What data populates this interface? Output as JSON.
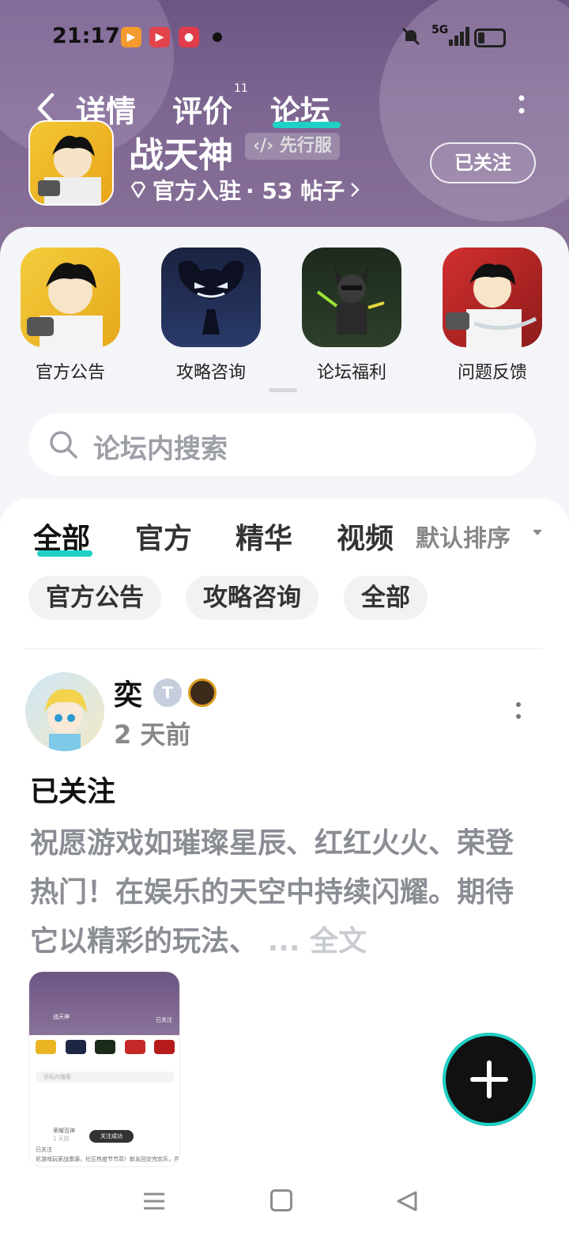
{
  "status_bar": {
    "time": "21:17",
    "network": "5G",
    "icons": [
      "bilibili-app-icon",
      "video-app-icon",
      "kuaishou-app-icon",
      "mute-icon",
      "signal-icon",
      "battery-icon"
    ]
  },
  "header": {
    "tabs": [
      {
        "label": "详情",
        "active": false
      },
      {
        "label": "评价",
        "active": false,
        "badge": "11"
      },
      {
        "label": "论坛",
        "active": true
      }
    ],
    "game_name": "战天神",
    "preview_tag": "先行服",
    "official_label": "官方入驻",
    "posts_label": "· 53 帖子",
    "follow_label": "已关注"
  },
  "shortcuts": [
    {
      "label": "官方公告",
      "color": "#e9b523"
    },
    {
      "label": "攻略咨询",
      "color": "#1d2744"
    },
    {
      "label": "论坛福利",
      "color": "#1c2a1c"
    },
    {
      "label": "问题反馈",
      "color": "#c62828"
    }
  ],
  "search": {
    "placeholder": "论坛内搜索"
  },
  "feed": {
    "tabs": [
      {
        "label": "全部",
        "active": true
      },
      {
        "label": "官方",
        "active": false
      },
      {
        "label": "精华",
        "active": false
      },
      {
        "label": "视频",
        "active": false
      }
    ],
    "sort_label": "默认排序",
    "chips": [
      "官方公告",
      "攻略咨询",
      "全部"
    ],
    "post": {
      "username": "奕",
      "level_badge": "T",
      "time": "2 天前",
      "title": "已关注",
      "body": "祝愿游戏如璀璨星辰、红红火火、荣登热门！在娱乐的天空中持续闪耀。期待它以精彩的玩法、",
      "ellipsis": "...",
      "full_text": "全文"
    },
    "thumbnail": {
      "game_name": "战天神",
      "follow_label": "已关注",
      "search_placeholder": "论坛内搜索",
      "toast": "关注成功",
      "post_user": "荣耀百神",
      "post_time": "1 天前",
      "post_title": "已关注",
      "post_body": "尼游戏玩家战激源，社区热度节节高！新友回交完欢乐，共创"
    }
  },
  "colors": {
    "accent": "#1fd1c5",
    "header_bg": "#7c6590"
  }
}
